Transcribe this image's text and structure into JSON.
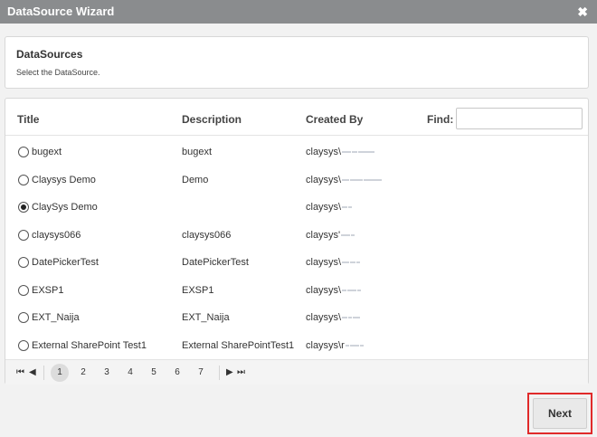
{
  "window": {
    "title": "DataSource Wizard",
    "close_glyph": "✖"
  },
  "header": {
    "title": "DataSources",
    "subtitle": "Select the DataSource."
  },
  "grid": {
    "columns": {
      "title": "Title",
      "description": "Description",
      "created_by": "Created By",
      "find": "Find:"
    },
    "find_value": "",
    "rows": [
      {
        "title": "bugext",
        "description": "bugext",
        "created_by": "claysys\\",
        "selected": false
      },
      {
        "title": "Claysys Demo",
        "description": "Demo",
        "created_by": "claysys\\",
        "selected": false
      },
      {
        "title": "ClaySys Demo",
        "description": "",
        "created_by": "claysys\\",
        "selected": true
      },
      {
        "title": "claysys066",
        "description": "claysys066",
        "created_by": "claysys'",
        "selected": false
      },
      {
        "title": "DatePickerTest",
        "description": "DatePickerTest",
        "created_by": "claysys\\",
        "selected": false
      },
      {
        "title": "EXSP1",
        "description": "EXSP1",
        "created_by": "claysys\\",
        "selected": false
      },
      {
        "title": "EXT_Naija",
        "description": "EXT_Naija",
        "created_by": "claysys\\",
        "selected": false
      },
      {
        "title": "External SharePoint Test1",
        "description": "External SharePointTest1",
        "created_by": "claysys\\r",
        "selected": false
      }
    ]
  },
  "pager": {
    "first": "⏮",
    "prev": "◀",
    "next": "▶",
    "last": "⏭",
    "pages": [
      "1",
      "2",
      "3",
      "4",
      "5",
      "6",
      "7"
    ],
    "current_page": "1"
  },
  "footer": {
    "next_label": "Next"
  },
  "colors": {
    "titlebar": "#8a8c8e",
    "highlight_border": "#e02a2a"
  }
}
